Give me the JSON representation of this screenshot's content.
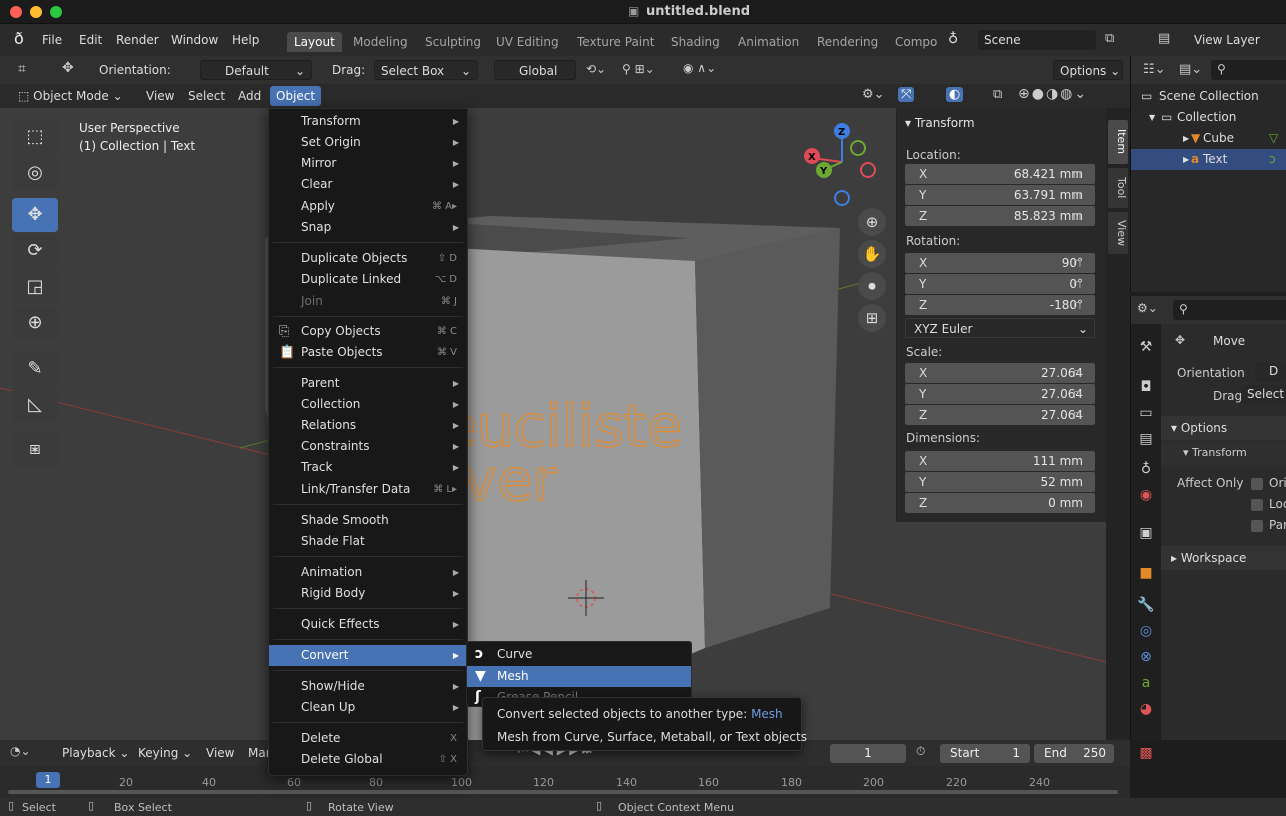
{
  "window": {
    "title": "untitled.blend"
  },
  "menubar": {
    "items": [
      "File",
      "Edit",
      "Render",
      "Window",
      "Help"
    ],
    "workspace_tabs": [
      "Layout",
      "Modeling",
      "Sculpting",
      "UV Editing",
      "Texture Paint",
      "Shading",
      "Animation",
      "Rendering",
      "Compo"
    ],
    "active_tab": "Layout",
    "scene": "Scene",
    "view_layer": "View Layer"
  },
  "tool_header": {
    "orientation_label": "Orientation:",
    "orientation_value": "Default",
    "drag_label": "Drag:",
    "drag_value": "Select Box",
    "transform_orientation": "Global",
    "options": "Options"
  },
  "mode_header": {
    "mode": "Object Mode",
    "menus": [
      "View",
      "Select",
      "Add",
      "Object"
    ],
    "active_menu": "Object"
  },
  "viewport": {
    "perspective": "User Perspective",
    "context": "(1) Collection | Text",
    "text_line1": "Sveuciliste",
    "text_line2": "Sever"
  },
  "object_menu": {
    "items": [
      {
        "label": "Transform",
        "shortcut": "",
        "submenu": true
      },
      {
        "label": "Set Origin",
        "shortcut": "",
        "submenu": true
      },
      {
        "label": "Mirror",
        "shortcut": "",
        "submenu": true
      },
      {
        "label": "Clear",
        "shortcut": "",
        "submenu": true
      },
      {
        "label": "Apply",
        "shortcut": "⌘ A▸",
        "submenu": false
      },
      {
        "label": "Snap",
        "shortcut": "",
        "submenu": true
      },
      {
        "label": "Duplicate Objects",
        "shortcut": "⇧ D",
        "submenu": false
      },
      {
        "label": "Duplicate Linked",
        "shortcut": "⌥ D",
        "submenu": false
      },
      {
        "label": "Join",
        "shortcut": "⌘ J",
        "submenu": false
      },
      {
        "label": "Copy Objects",
        "shortcut": "⌘ C",
        "submenu": false
      },
      {
        "label": "Paste Objects",
        "shortcut": "⌘ V",
        "submenu": false
      },
      {
        "label": "Parent",
        "shortcut": "",
        "submenu": true
      },
      {
        "label": "Collection",
        "shortcut": "",
        "submenu": true
      },
      {
        "label": "Relations",
        "shortcut": "",
        "submenu": true
      },
      {
        "label": "Constraints",
        "shortcut": "",
        "submenu": true
      },
      {
        "label": "Track",
        "shortcut": "",
        "submenu": true
      },
      {
        "label": "Link/Transfer Data",
        "shortcut": "⌘ L▸",
        "submenu": false
      },
      {
        "label": "Shade Smooth",
        "shortcut": "",
        "submenu": false
      },
      {
        "label": "Shade Flat",
        "shortcut": "",
        "submenu": false
      },
      {
        "label": "Animation",
        "shortcut": "",
        "submenu": true
      },
      {
        "label": "Rigid Body",
        "shortcut": "",
        "submenu": true
      },
      {
        "label": "Quick Effects",
        "shortcut": "",
        "submenu": true
      },
      {
        "label": "Convert",
        "shortcut": "",
        "submenu": true
      },
      {
        "label": "Show/Hide",
        "shortcut": "",
        "submenu": true
      },
      {
        "label": "Clean Up",
        "shortcut": "",
        "submenu": true
      },
      {
        "label": "Delete",
        "shortcut": "X",
        "submenu": false
      },
      {
        "label": "Delete Global",
        "shortcut": "⇧ X",
        "submenu": false
      }
    ]
  },
  "convert_submenu": {
    "items": [
      "Curve",
      "Mesh",
      "Grease Pencil"
    ],
    "highlighted": "Mesh"
  },
  "tooltip": {
    "line1": "Convert selected objects to another type:",
    "line1_value": "Mesh",
    "line2": "Mesh from Curve, Surface, Metaball, or Text objects"
  },
  "npanel": {
    "header": "Transform",
    "location_label": "Location:",
    "location": [
      {
        "axis": "X",
        "value": "68.421 mm"
      },
      {
        "axis": "Y",
        "value": "63.791 mm"
      },
      {
        "axis": "Z",
        "value": "85.823 mm"
      }
    ],
    "rotation_label": "Rotation:",
    "rotation": [
      {
        "axis": "X",
        "value": "90°"
      },
      {
        "axis": "Y",
        "value": "0°"
      },
      {
        "axis": "Z",
        "value": "-180°"
      }
    ],
    "rotation_mode": "XYZ Euler",
    "scale_label": "Scale:",
    "scale": [
      {
        "axis": "X",
        "value": "27.064"
      },
      {
        "axis": "Y",
        "value": "27.064"
      },
      {
        "axis": "Z",
        "value": "27.064"
      }
    ],
    "dimensions_label": "Dimensions:",
    "dimensions": [
      {
        "axis": "X",
        "value": "111 mm"
      },
      {
        "axis": "Y",
        "value": "52 mm"
      },
      {
        "axis": "Z",
        "value": "0 mm"
      }
    ],
    "tabs": [
      "Item",
      "Tool",
      "View"
    ]
  },
  "outliner": {
    "scene_collection": "Scene Collection",
    "collection": "Collection",
    "objects": [
      "Cube",
      "Text"
    ],
    "selected": "Text"
  },
  "properties": {
    "move": "Move",
    "orientation_label": "Orientation",
    "orientation_value": "D",
    "drag_label": "Drag:",
    "drag_value": "Select",
    "options": "Options",
    "transform": "Transform",
    "affect_only": "Affect Only",
    "checks": [
      "Ori",
      "Loc",
      "Par"
    ],
    "workspace": "Workspace"
  },
  "timeline": {
    "menus": [
      "Playback",
      "Keying",
      "View",
      "Mar"
    ],
    "current_frame": "1",
    "start_label": "Start",
    "start": "1",
    "end_label": "End",
    "end": "250",
    "ticks": [
      "1",
      "20",
      "40",
      "60",
      "80",
      "100",
      "120",
      "140",
      "160",
      "180",
      "200",
      "220",
      "240"
    ]
  },
  "statusbar": {
    "select": "Select",
    "box_select": "Box Select",
    "rotate_view": "Rotate View",
    "context_menu": "Object Context Menu"
  },
  "colors": {
    "accent": "#4772b3",
    "text_orange": "#e08a2c",
    "x_axis": "#e04a5a",
    "y_axis": "#6ca832",
    "z_axis": "#3e7ee0"
  }
}
